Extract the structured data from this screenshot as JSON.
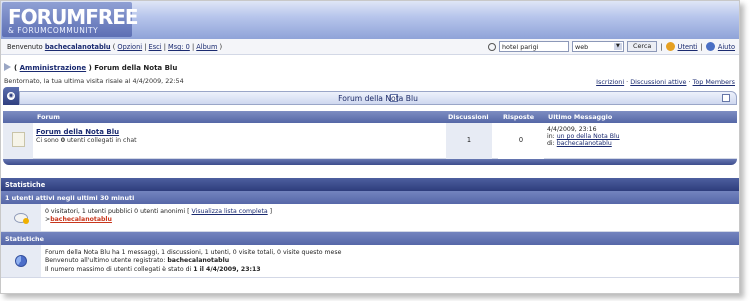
{
  "brand": {
    "logo": "FORUMFREE",
    "sub": "& FORUMCOMMUNITY"
  },
  "userbar": {
    "welcome_prefix": "Benvenuto",
    "username": "bachecalanotablu",
    "links": [
      "Opzioni",
      "Esci",
      "Msg: 0",
      "Album"
    ],
    "search_value": "hotel parigi",
    "search_scope": "web",
    "search_button": "Cerca",
    "users_link": "Utenti",
    "help_link": "Aiuto"
  },
  "breadcrumb": {
    "parent": "Amministrazione",
    "current": "Forum della Nota Blu"
  },
  "last_visit": "Bentornato, la tua ultima visita risale al 4/4/2009, 22:54",
  "top_links": [
    "Iscrizioni",
    "Discussioni attive",
    "Top Members"
  ],
  "category": {
    "title": "Forum della Nota Blu",
    "headers": {
      "forum": "Forum",
      "topics": "Discussioni",
      "replies": "Risposte",
      "last": "Ultimo Messaggio"
    },
    "rows": [
      {
        "name": "Forum della Nota Blu",
        "sub_prefix": "Ci sono",
        "sub_count": "0",
        "sub_suffix": "utenti collegati in chat",
        "topics": "1",
        "replies": "0",
        "last_date": "4/4/2009, 23:16",
        "last_in_prefix": "in:",
        "last_in": "un po della Nota Blu",
        "last_by_prefix": "di:",
        "last_by": "bachecalanotablu"
      }
    ]
  },
  "stats": {
    "header": "Statistiche",
    "active_header": "1 utenti attivi negli ultimi 30 minuti",
    "active_line": "0 visitatori, 1 utenti pubblici 0 utenti anonimi [",
    "active_link": "Visualizza lista completa",
    "active_close": "]",
    "active_user": "bachecalanotablu",
    "header2": "Statistiche",
    "line1": "Forum della Nota Blu ha 1 messaggi, 1 discussioni, 1 utenti, 0 visite totali, 0 visite questo mese",
    "line2_prefix": "Benvenuto all'ultimo utente registrato:",
    "line2_user": "bachecalanotablu",
    "line3_prefix": "Il numero massimo di utenti collegati è stato di",
    "line3_value": "1 il 4/4/2009, 23:13"
  }
}
